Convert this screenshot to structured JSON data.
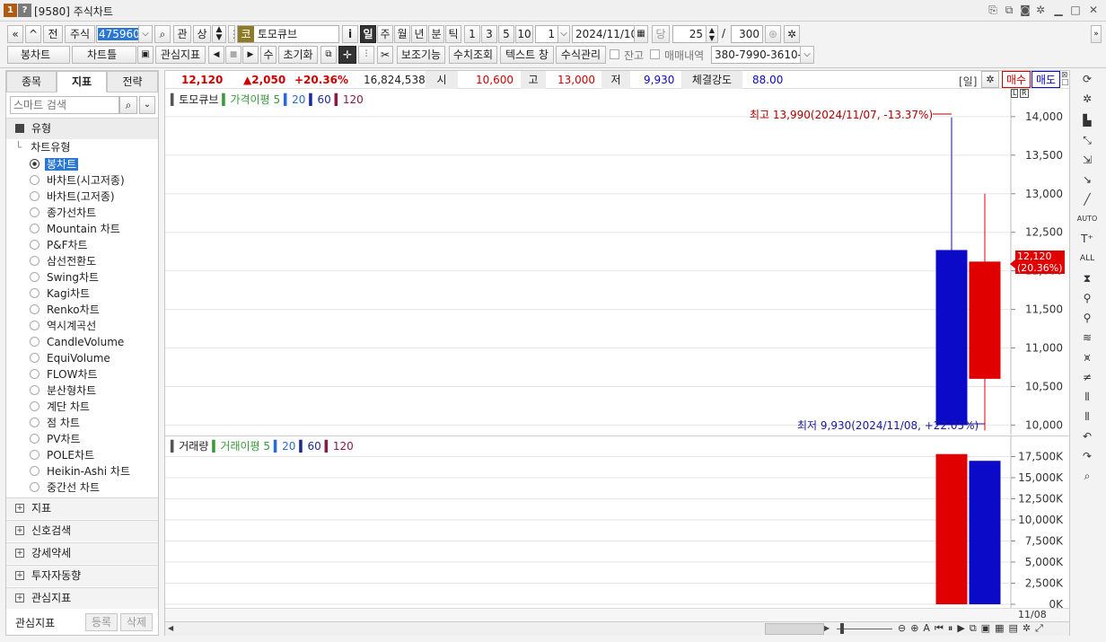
{
  "window": {
    "badge1": "1",
    "badge2": "?",
    "title": "[9580] 주식차트"
  },
  "toolbar": {
    "prev_prev": "«",
    "prev": "^",
    "jeon": "전",
    "market": "주식",
    "code": "475960",
    "search_icon": "⌕",
    "gwan": "관",
    "sang": "상",
    "name_badge": "코",
    "name": "토모큐브",
    "info": "i",
    "periods": [
      "일",
      "주",
      "월",
      "년",
      "분",
      "틱"
    ],
    "intervals": [
      "1",
      "3",
      "5",
      "10"
    ],
    "interval_value": "1",
    "date": "2024/11/10",
    "dang": "당",
    "count": "25",
    "slash": "/",
    "total": "300",
    "chart_type": "봉차트",
    "template": "차트틀",
    "watch": "관심지표",
    "su": "수",
    "reset": "초기화",
    "aux": "보조기능",
    "value_view": "수치조회",
    "text_window": "텍스트 창",
    "formula": "수식관리",
    "janko": "잔고",
    "trade_history": "매매내역",
    "account": "380-7990-3610-1"
  },
  "left": {
    "tabs": [
      "종목",
      "지표",
      "전략"
    ],
    "search_placeholder": "스마트 검색",
    "section_type": "유형",
    "subsection": "차트유형",
    "items": [
      "봉차트",
      "바차트(시고저종)",
      "바차트(고저종)",
      "종가선차트",
      "Mountain 차트",
      "P&F차트",
      "삼선전환도",
      "Swing차트",
      "Kagi차트",
      "Renko차트",
      "역시계곡선",
      "CandleVolume",
      "EquiVolume",
      "FLOW차트",
      "분산형차트",
      "계단 차트",
      "점 차트",
      "PV차트",
      "POLE차트",
      "Heikin-Ashi 차트",
      "중간선 차트"
    ],
    "selected": 0,
    "sections": [
      "지표",
      "신호검색",
      "강세약세",
      "투자자동향",
      "관심지표"
    ],
    "footer_label": "관심지표",
    "register": "등록",
    "delete": "삭제"
  },
  "quote": {
    "price": "12,120",
    "change": "▲2,050",
    "rate": "+20.36%",
    "volume": "16,824,538",
    "open_label": "시",
    "open": "10,600",
    "high_label": "고",
    "high": "13,000",
    "low_label": "저",
    "low": "9,930",
    "strength_label": "체결강도",
    "strength": "88.00",
    "period_tag": "[일]",
    "buy": "매수",
    "sell": "매도"
  },
  "price_legend": {
    "name": "토모큐브",
    "ma_label": "가격이평",
    "ma": [
      "5",
      "20",
      "60",
      "120"
    ]
  },
  "vol_legend": {
    "name": "거래량",
    "ma_label": "거래이평",
    "ma": [
      "5",
      "20",
      "60",
      "120"
    ]
  },
  "annotations": {
    "high": "최고 13,990(2024/11/07, -13.37%)",
    "low": "최저 9,930(2024/11/08, +22.05%)",
    "current": "12,120",
    "current_rate": "(20.36%)"
  },
  "price_ticks": [
    "14,000",
    "13,500",
    "13,000",
    "12,500",
    "12,000",
    "11,500",
    "11,000",
    "10,500",
    "10,000"
  ],
  "vol_ticks": [
    "17,500K",
    "15,000K",
    "12,500K",
    "10,000K",
    "7,500K",
    "5,000K",
    "2,500K",
    "0K"
  ],
  "x_label": "11/08",
  "axis_tags": [
    "L",
    "R"
  ],
  "chart_data": {
    "type": "candlestick",
    "price": [
      {
        "open": 12270,
        "high": 13990,
        "low": 10000,
        "close": 10000,
        "color": "#0a0ac8"
      },
      {
        "open": 10600,
        "high": 13000,
        "low": 9930,
        "close": 12120,
        "color": "#e00000"
      }
    ],
    "price_range": [
      9900,
      14150
    ],
    "volume": [
      {
        "value": 17800000,
        "color": "#e00000"
      },
      {
        "value": 17000000,
        "color": "#0a0ac8"
      }
    ],
    "volume_range": [
      0,
      18300000
    ]
  },
  "colors": {
    "up": "#e00000",
    "down": "#0a0ac8",
    "ma5": "#3a9a3a",
    "ma20": "#2a6ad4",
    "ma60": "#1a2a9a",
    "ma120": "#8a1a4a"
  }
}
